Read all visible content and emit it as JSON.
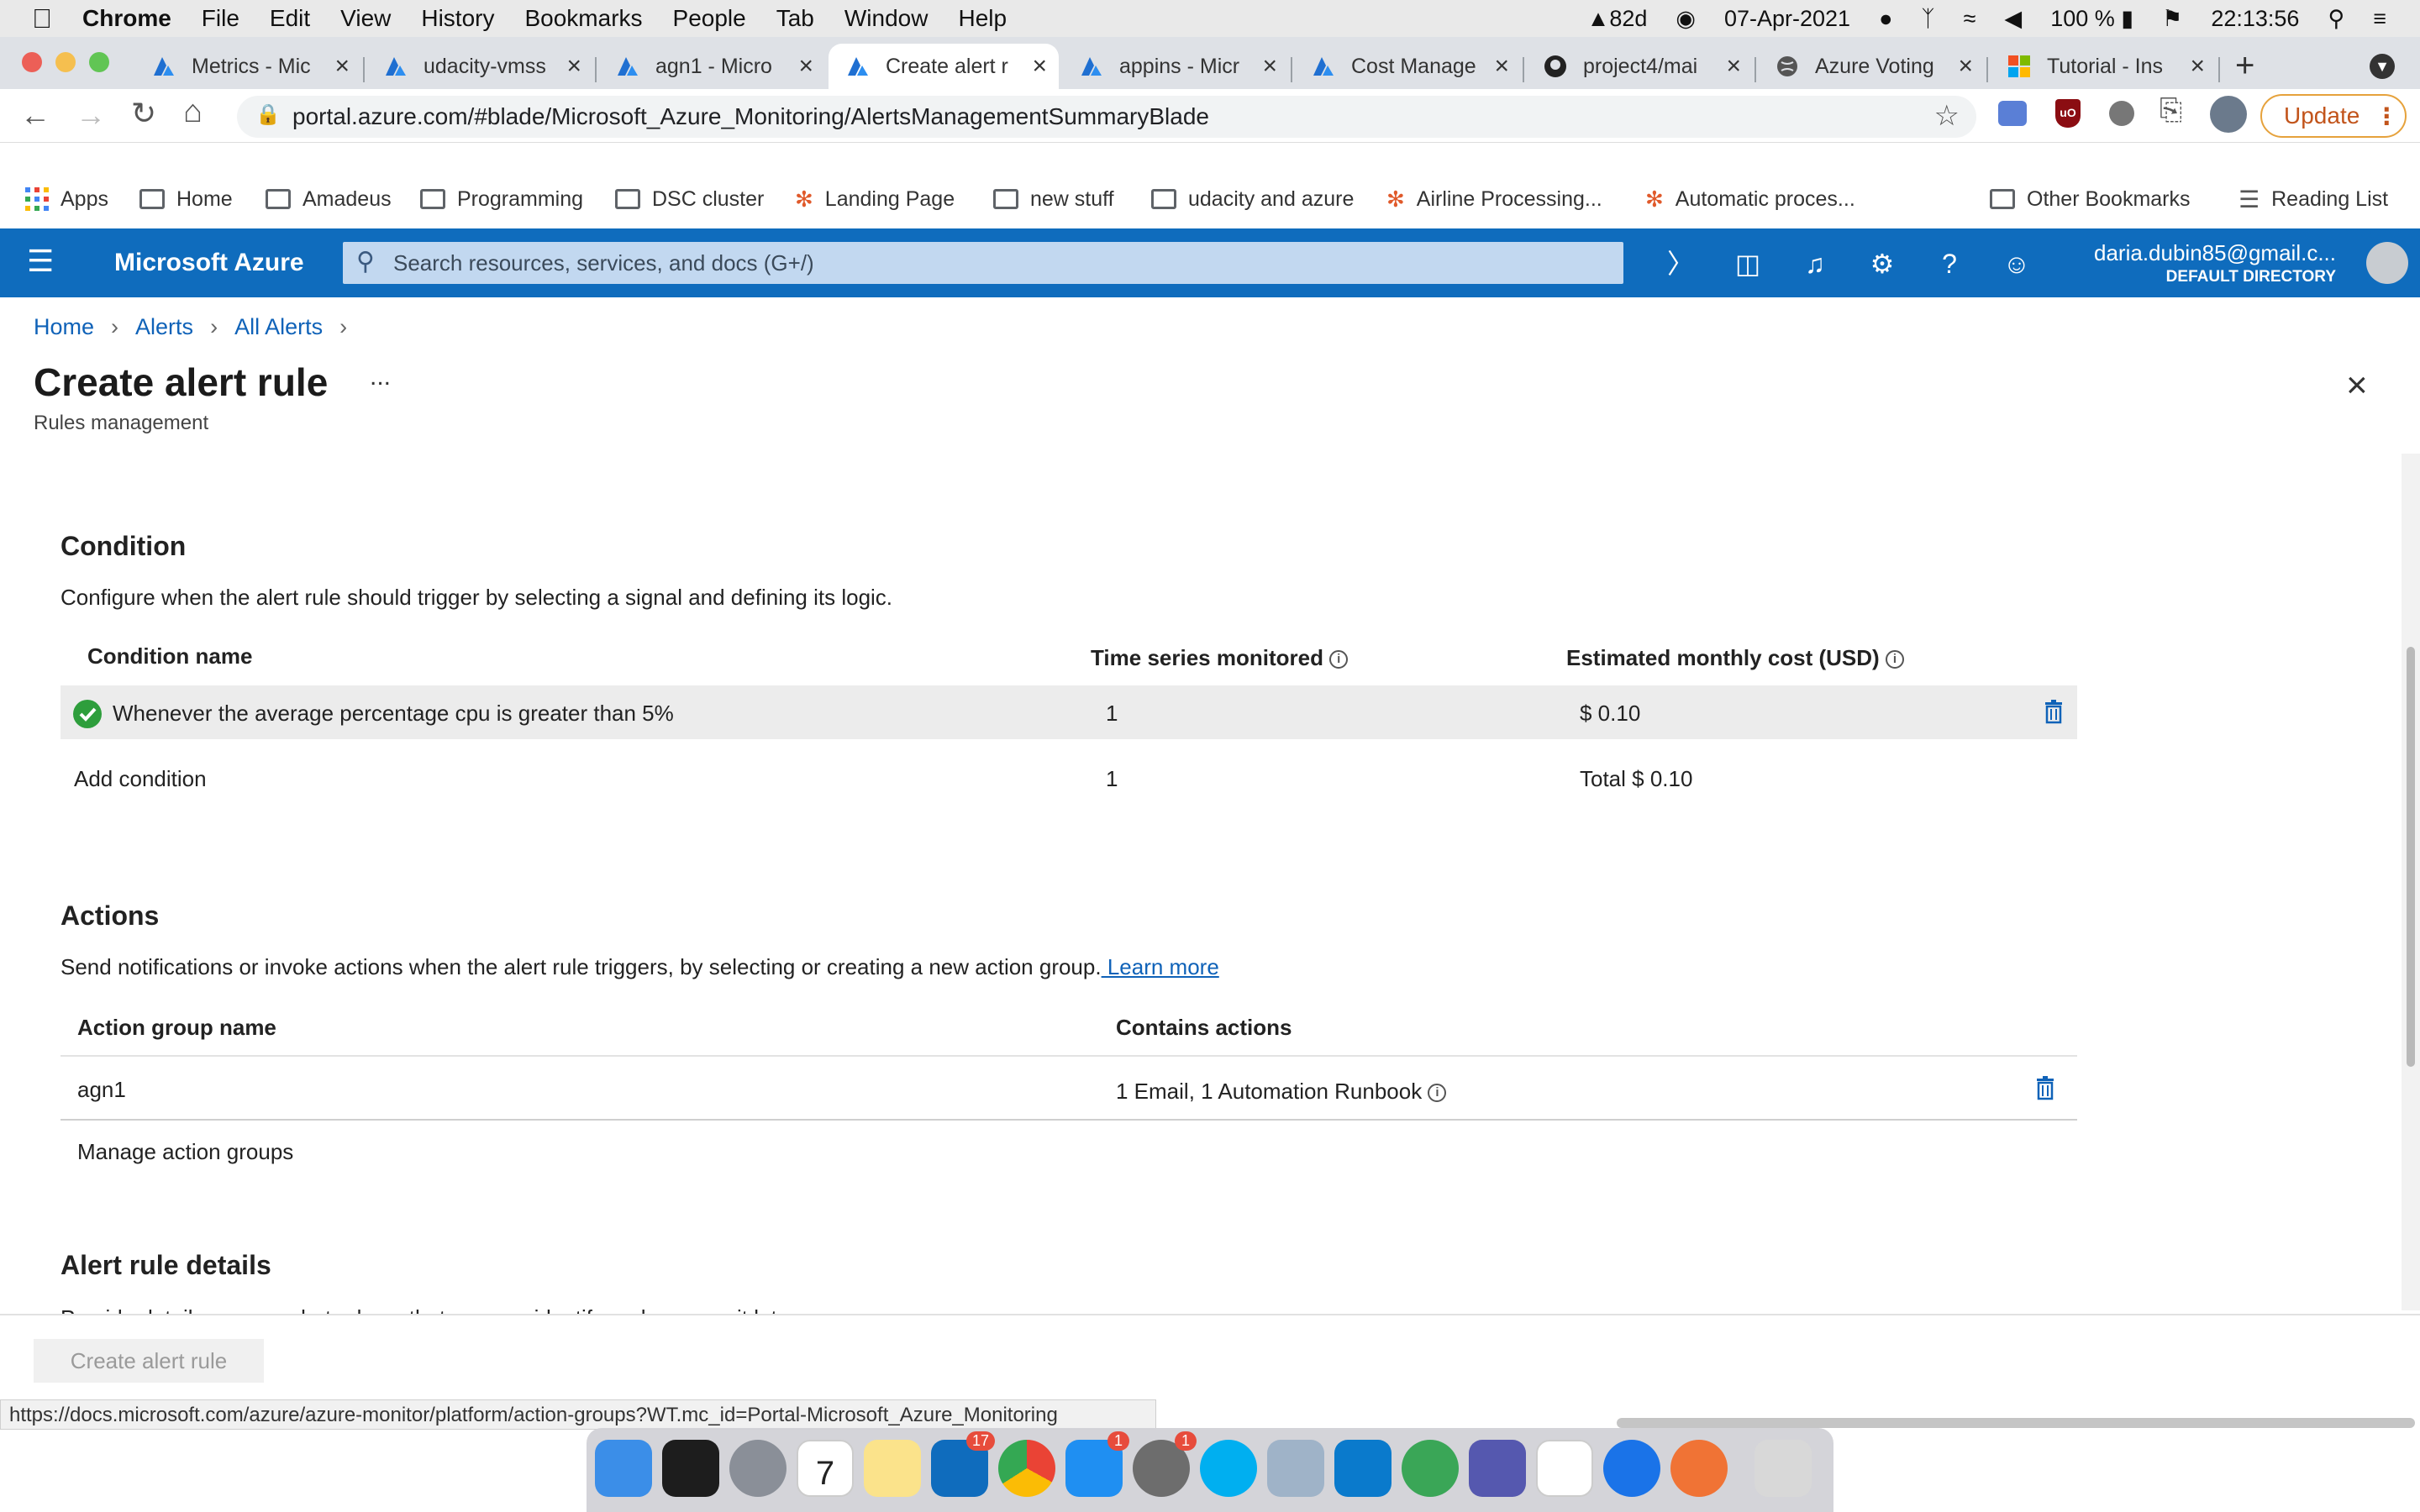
{
  "menubar": {
    "app": "Chrome",
    "items": [
      "File",
      "Edit",
      "View",
      "History",
      "Bookmarks",
      "People",
      "Tab",
      "Window",
      "Help"
    ],
    "status": {
      "temp": "82d",
      "date": "07-Apr-2021",
      "battery": "100 %",
      "time": "22:13:56"
    }
  },
  "tabs": [
    {
      "label": "Metrics - Mic"
    },
    {
      "label": "udacity-vmss"
    },
    {
      "label": "agn1 - Micro"
    },
    {
      "label": "Create alert r"
    },
    {
      "label": "appins - Micr"
    },
    {
      "label": "Cost Manage"
    },
    {
      "label": "project4/mai"
    },
    {
      "label": "Azure Voting"
    },
    {
      "label": "Tutorial - Ins"
    }
  ],
  "address": {
    "url": "portal.azure.com/#blade/Microsoft_Azure_Monitoring/AlertsManagementSummaryBlade",
    "update": "Update"
  },
  "bookmarks": [
    "Apps",
    "Home",
    "Amadeus",
    "Programming",
    "DSC cluster",
    "Landing Page",
    "new stuff",
    "udacity and azure",
    "Airline Processing...",
    "Automatic proces...",
    "Other Bookmarks",
    "Reading List"
  ],
  "azure": {
    "brand": "Microsoft Azure",
    "search_placeholder": "Search resources, services, and docs (G+/)",
    "user": "daria.dubin85@gmail.c...",
    "directory": "DEFAULT DIRECTORY"
  },
  "breadcrumb": [
    "Home",
    "Alerts",
    "All Alerts"
  ],
  "page": {
    "title": "Create alert rule",
    "subtitle": "Rules management",
    "more": "..."
  },
  "condition": {
    "heading": "Condition",
    "desc": "Configure when the alert rule should trigger by selecting a signal and defining its logic.",
    "col_name": "Condition name",
    "col_series": "Time series monitored",
    "col_cost": "Estimated monthly cost (USD)",
    "row_name": "Whenever the average percentage cpu is greater than 5%",
    "row_series": "1",
    "row_cost": "$ 0.10",
    "add": "Add condition",
    "total_series": "1",
    "total_cost": "Total $ 0.10"
  },
  "actions": {
    "heading": "Actions",
    "desc": "Send notifications or invoke actions when the alert rule triggers, by selecting or creating a new action group.",
    "learn": " Learn more",
    "col_name": "Action group name",
    "col_contains": "Contains actions",
    "row_name": "agn1",
    "row_contains": "1 Email, 1 Automation Runbook",
    "manage": "Manage action groups"
  },
  "details": {
    "heading": "Alert rule details",
    "desc": "Provide details on your alert rule so that you can identify and manage it later."
  },
  "footer": {
    "create": "Create alert rule"
  },
  "statusbar": {
    "url": "https://docs.microsoft.com/azure/azure-monitor/platform/action-groups?WT.mc_id=Portal-Microsoft_Azure_Monitoring"
  },
  "dock": {
    "outlook_badge": "17",
    "appstore_badge": "1",
    "prefs_badge": "1"
  }
}
